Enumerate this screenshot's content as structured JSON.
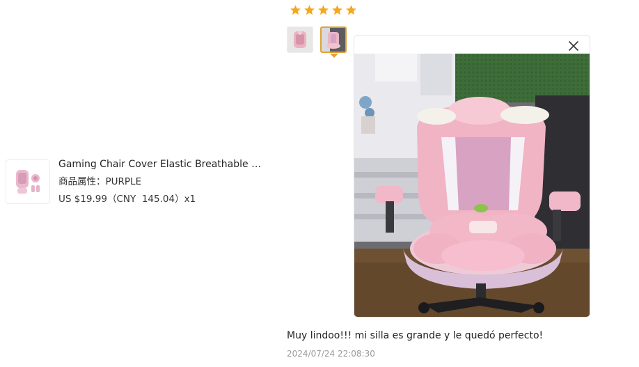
{
  "product": {
    "title": "Gaming Chair Cover Elastic Breathable Dus...",
    "attribute": "商品属性：PURPLE",
    "price": "US $19.99（CNY  145.04）x1",
    "thumbnail_icon": "pink-chair-cover-image"
  },
  "review": {
    "rating": 5,
    "star_color": "#f5a623",
    "photos": [
      {
        "icon": "pink-chair-photo-thumbnail"
      },
      {
        "icon": "pink-chair-photo-thumbnail",
        "selected": true
      }
    ],
    "viewer": {
      "close_icon": "close-icon",
      "photo_icon": "pink-gaming-chair-photo"
    },
    "text": "Muy lindoo!!! mi silla es grande y le quedó perfecto!",
    "date": "2024/07/24 22:08:30"
  },
  "colors": {
    "accent": "#e0a13a",
    "text": "#222222",
    "muted": "#999999"
  }
}
